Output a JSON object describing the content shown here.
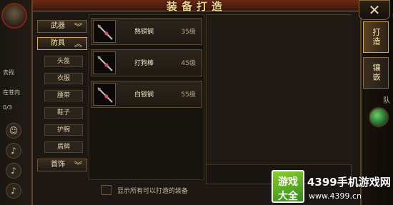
{
  "window": {
    "title": "装备打造",
    "close_glyph": "✕"
  },
  "categories": {
    "weapon": {
      "label": "武器",
      "expanded": false
    },
    "armor": {
      "label": "防具",
      "expanded": true,
      "items": [
        "头盔",
        "衣服",
        "腰带",
        "鞋子",
        "护腕",
        "盾牌"
      ]
    },
    "jewelry": {
      "label": "首饰",
      "expanded": false
    }
  },
  "recipes": [
    {
      "name": "熟铜锏",
      "level": "35级",
      "icon": "mace-icon"
    },
    {
      "name": "打狗棒",
      "level": "45级",
      "icon": "staff-icon"
    },
    {
      "name": "白银锏",
      "level": "55级",
      "icon": "mace-icon"
    }
  ],
  "detail": {
    "show_all_label": "显示所有可以打造的装备",
    "show_all_checked": false
  },
  "side_tabs": [
    {
      "label": "打造",
      "active": true
    },
    {
      "label": "镶嵌",
      "active": false
    }
  ],
  "hud": {
    "left_text_1": "去找",
    "left_text_2": "在苍内",
    "left_counter": "0/3",
    "right_label": "队"
  },
  "watermark": {
    "logo_top": "游戏",
    "logo_bottom": "大全",
    "title": "4399手机游戏网",
    "url": "www.4399.cn"
  },
  "colors": {
    "title_gold": "#f0d68a",
    "panel_bg": "#1d1813",
    "border_bronze": "#5b4526",
    "active_tab": "#d4a94a"
  }
}
